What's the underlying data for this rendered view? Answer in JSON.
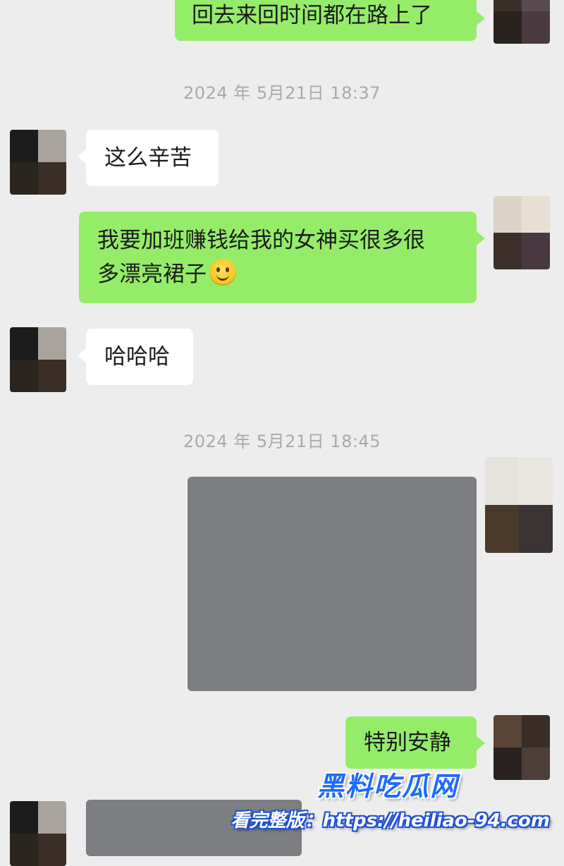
{
  "messages": {
    "m1": {
      "text": "回去来回时间都在路上了"
    },
    "ts1": "2024 年 5月21日 18:37",
    "m2": {
      "text": "这么辛苦"
    },
    "m3": {
      "line1": "我要加班赚钱给我的女神买很多很",
      "line2": "多漂亮裙子",
      "emoji": "smiley-emoji"
    },
    "m4": {
      "text": "哈哈哈"
    },
    "ts2": "2024 年 5月21日 18:45",
    "m6": {
      "text": "特别安静"
    }
  },
  "watermark": {
    "title": "黑料吃瓜网",
    "url": "看完整版：https://heiliao-94.com"
  },
  "colors": {
    "background": "#ededed",
    "outgoing_bubble": "#95ec69",
    "incoming_bubble": "#ffffff",
    "image_placeholder": "#7c7e81",
    "timestamp_text": "#a9a9a9",
    "watermark_blue": "#1e6bff"
  }
}
